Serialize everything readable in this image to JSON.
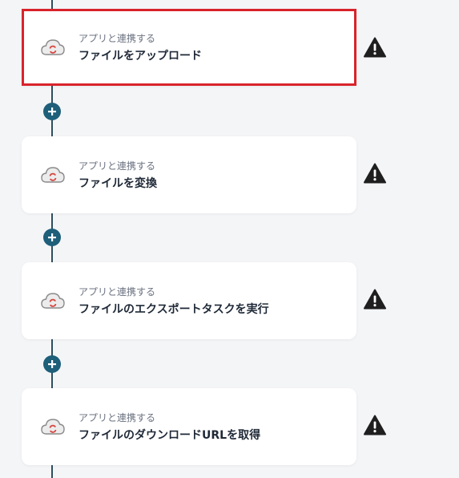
{
  "steps": [
    {
      "subtitle": "アプリと連携する",
      "title": "ファイルをアップロード",
      "selected": true
    },
    {
      "subtitle": "アプリと連携する",
      "title": "ファイルを変換",
      "selected": false
    },
    {
      "subtitle": "アプリと連携する",
      "title": "ファイルのエクスポートタスクを実行",
      "selected": false
    },
    {
      "subtitle": "アプリと連携する",
      "title": "ファイルのダウンロードURLを取得",
      "selected": false
    }
  ],
  "icons": {
    "app": "cloud-convert-icon",
    "warning": "warning-icon",
    "add": "plus-icon"
  },
  "colors": {
    "selected_border": "#d9232b",
    "add_button": "#1e5f7a",
    "app_icon_accent": "#d64540"
  }
}
